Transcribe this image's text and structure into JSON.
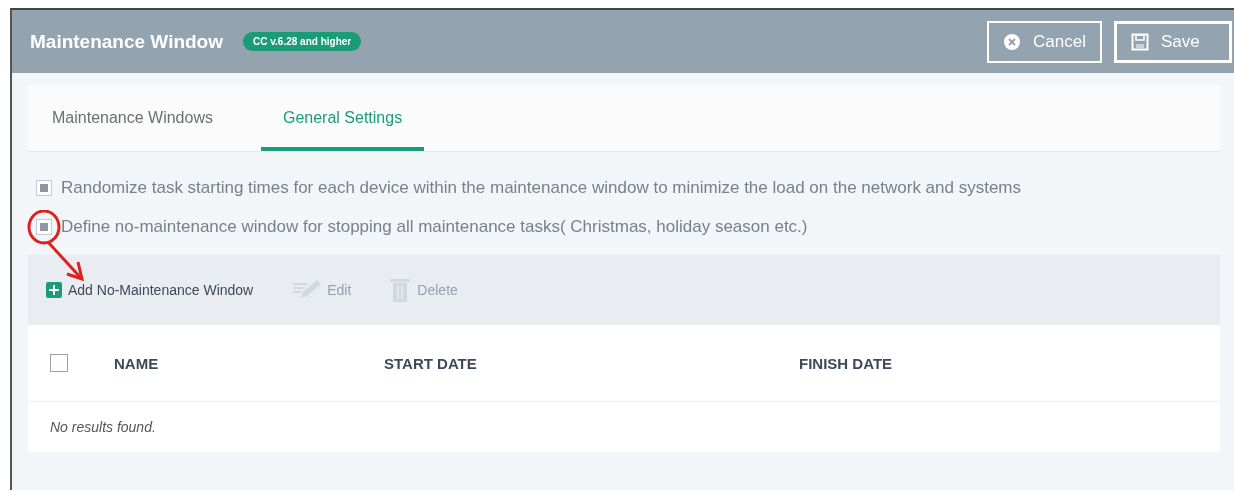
{
  "window": {
    "title": "Maintenance Window",
    "badge": "CC v.6.28 and higher"
  },
  "header_buttons": [
    {
      "kind": "cancel",
      "label": "Cancel"
    },
    {
      "kind": "save",
      "label": "Save"
    }
  ],
  "tabs": [
    {
      "label": "Maintenance Windows",
      "selected": false
    },
    {
      "label": "General Settings",
      "selected": true
    }
  ],
  "options": [
    {
      "label": "Randomize task starting times for each device within the maintenance window to minimize the load on the network and systems",
      "checked": true
    },
    {
      "label": "Define no-maintenance window for stopping all maintenance tasks( Christmas, holiday season etc.)",
      "checked": true,
      "annotated": true
    }
  ],
  "toolbar": [
    {
      "kind": "add",
      "label": "Add No-Maintenance Window",
      "disabled": false
    },
    {
      "kind": "edit",
      "label": "Edit",
      "disabled": true
    },
    {
      "kind": "delete",
      "label": "Delete",
      "disabled": true
    }
  ],
  "table": {
    "select_all_checked": false,
    "columns": [
      "NAME",
      "START DATE",
      "FINISH DATE"
    ],
    "empty_message": "No results found."
  }
}
